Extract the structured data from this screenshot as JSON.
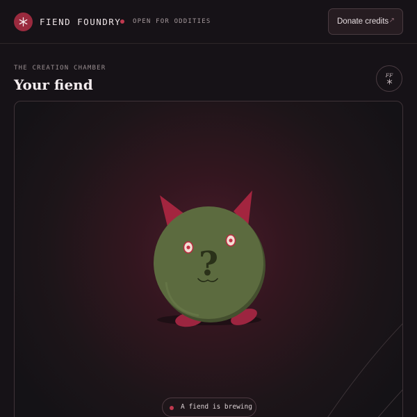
{
  "header": {
    "brand": "FIEND FOUNDRY",
    "status": "OPEN FOR ODDITIES",
    "donate_label": "Donate credits",
    "donate_icon": "arrow-up-right-icon",
    "logo_icon": "asterisk-icon"
  },
  "section": {
    "label": "THE CREATION CHAMBER",
    "title": "Your fiend",
    "badge_text": "FF",
    "badge_icon": "asterisk-icon"
  },
  "chamber": {
    "creature": "mystery-fiend",
    "face_glyph": "?",
    "status": "A fiend is brewing"
  },
  "colors": {
    "background": "#161217",
    "accent": "#9a2a3e",
    "fiend_body": "#5b6b3e",
    "horns_feet": "#a8263f"
  }
}
